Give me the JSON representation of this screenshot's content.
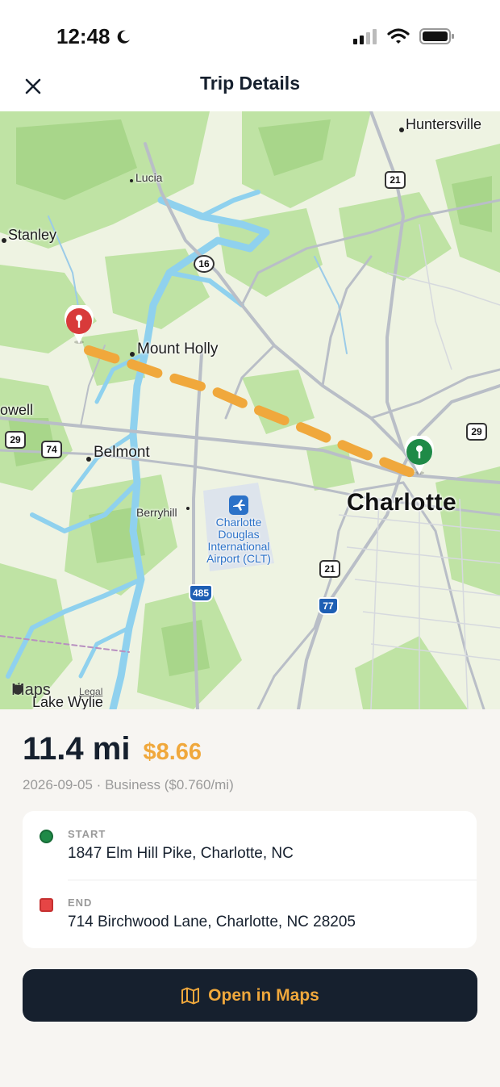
{
  "status_bar": {
    "time": "12:48",
    "icons": [
      "moon-icon",
      "cellular-signal-icon",
      "wifi-icon",
      "battery-icon"
    ]
  },
  "nav": {
    "title": "Trip Details",
    "close_icon": "close-icon"
  },
  "map": {
    "labels": {
      "huntersville": "Huntersville",
      "lucia": "Lucia",
      "stanley": "Stanley",
      "mount_holly": "Mount Holly",
      "lowell": "owell",
      "belmont": "Belmont",
      "berryhill": "Berryhill",
      "charlotte": "Charlotte",
      "airport": "Charlotte Douglas International Airport (CLT)",
      "lake_wylie": "Lake Wylie"
    },
    "highways": {
      "us21_top": "21",
      "nc16": "16",
      "us29_left": "29",
      "i74": "74",
      "us29_right": "29",
      "us21_bottom": "21",
      "i485": "485",
      "i77": "77"
    },
    "attribution": "Maps",
    "legal": "Legal",
    "colors": {
      "route": "#f0a83c",
      "start_pin": "#1f8a47",
      "end_pin": "#d83a3a",
      "water": "#8fd1ee",
      "greenery": "#bfe3a4"
    }
  },
  "trip": {
    "distance": "11.4 mi",
    "amount": "$8.66",
    "meta": "2026-09-05 · Business ($0.760/mi)"
  },
  "start": {
    "label": "START",
    "address": "1847 Elm Hill Pike, Charlotte, NC"
  },
  "end": {
    "label": "END",
    "address": "714 Birchwood Lane, Charlotte, NC 28205"
  },
  "actions": {
    "open_maps_label": "Open in Maps",
    "open_maps_icon": "map-icon"
  },
  "theme": {
    "accent": "#f0a83c",
    "dark": "#16202e"
  }
}
